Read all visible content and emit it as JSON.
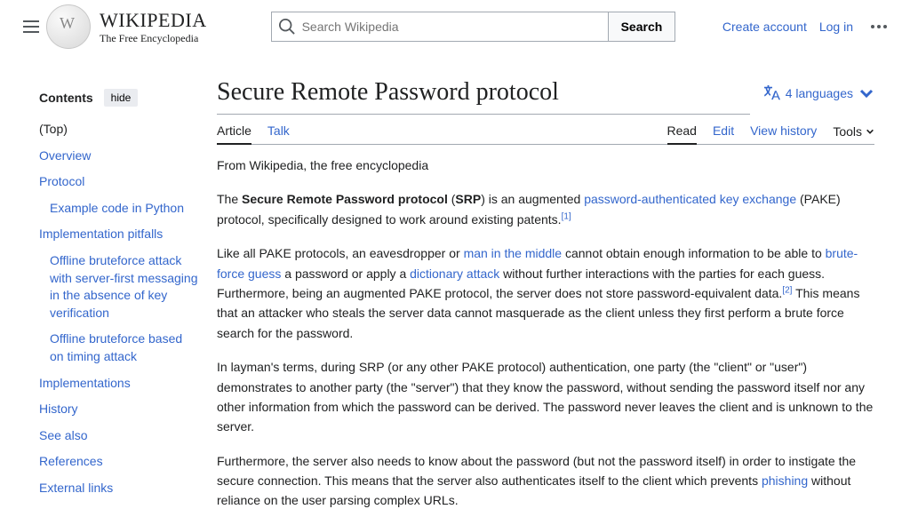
{
  "header": {
    "wordmark": "WIKIPEDIA",
    "tagline": "The Free Encyclopedia",
    "search_placeholder": "Search Wikipedia",
    "search_button": "Search",
    "create_account": "Create account",
    "log_in": "Log in"
  },
  "sidebar": {
    "heading": "Contents",
    "hide": "hide",
    "items": {
      "top": "(Top)",
      "overview": "Overview",
      "protocol": "Protocol",
      "example": "Example code in Python",
      "pitfalls": "Implementation pitfalls",
      "offline1": "Offline bruteforce attack with server-first messaging in the absence of key verification",
      "offline2": "Offline bruteforce based on timing attack",
      "implementations": "Implementations",
      "history": "History",
      "seealso": "See also",
      "references": "References",
      "external": "External links"
    }
  },
  "article": {
    "title": "Secure Remote Password protocol",
    "languages": "4 languages",
    "tabs": {
      "article": "Article",
      "talk": "Talk",
      "read": "Read",
      "edit": "Edit",
      "history": "View history",
      "tools": "Tools"
    },
    "from": "From Wikipedia, the free encyclopedia",
    "p1": {
      "t1": "The ",
      "b1": "Secure Remote Password protocol",
      "t2": " (",
      "b2": "SRP",
      "t3": ") is an augmented ",
      "l1": "password-authenticated key exchange",
      "t4": " (PAKE) protocol, specifically designed to work around existing patents.",
      "ref": "[1]"
    },
    "p2": {
      "t1": "Like all PAKE protocols, an eavesdropper or ",
      "l1": "man in the middle",
      "t2": " cannot obtain enough information to be able to ",
      "l2": "brute-force guess",
      "t3": " a password or apply a ",
      "l3": "dictionary attack",
      "t4": " without further interactions with the parties for each guess. Furthermore, being an augmented PAKE protocol, the server does not store password-equivalent data.",
      "ref": "[2]",
      "t5": " This means that an attacker who steals the server data cannot masquerade as the client unless they first perform a brute force search for the password."
    },
    "p3": "In layman's terms, during SRP (or any other PAKE protocol) authentication, one party (the \"client\" or \"user\") demonstrates to another party (the \"server\") that they know the password, without sending the password itself nor any other information from which the password can be derived. The password never leaves the client and is unknown to the server.",
    "p4": {
      "t1": "Furthermore, the server also needs to know about the password (but not the password itself) in order to instigate the secure connection. This means that the server also authenticates itself to the client which prevents ",
      "l1": "phishing",
      "t2": " without reliance on the user parsing complex URLs."
    }
  }
}
